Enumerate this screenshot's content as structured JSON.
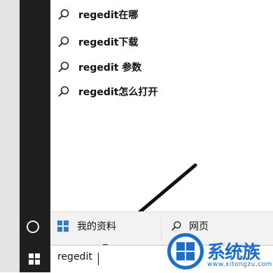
{
  "suggestions": [
    {
      "label": "regedit在哪"
    },
    {
      "label": "regedit下载"
    },
    {
      "label": "regedit 参数"
    },
    {
      "label": "regedit怎么打开"
    }
  ],
  "bottom": {
    "my_data": "我的资料",
    "web": "网页"
  },
  "search": {
    "value": "regedit"
  },
  "watermark": {
    "name": "系统族",
    "url": "www.xitongzu.com"
  },
  "colors": {
    "rail": "#1f1f1f",
    "accent": "#1b6fc9"
  },
  "icons": {
    "suggestion": "search-icon",
    "my_data": "windows-logo-icon",
    "web": "search-icon",
    "start": "windows-start-icon",
    "cortana": "circle-icon"
  }
}
